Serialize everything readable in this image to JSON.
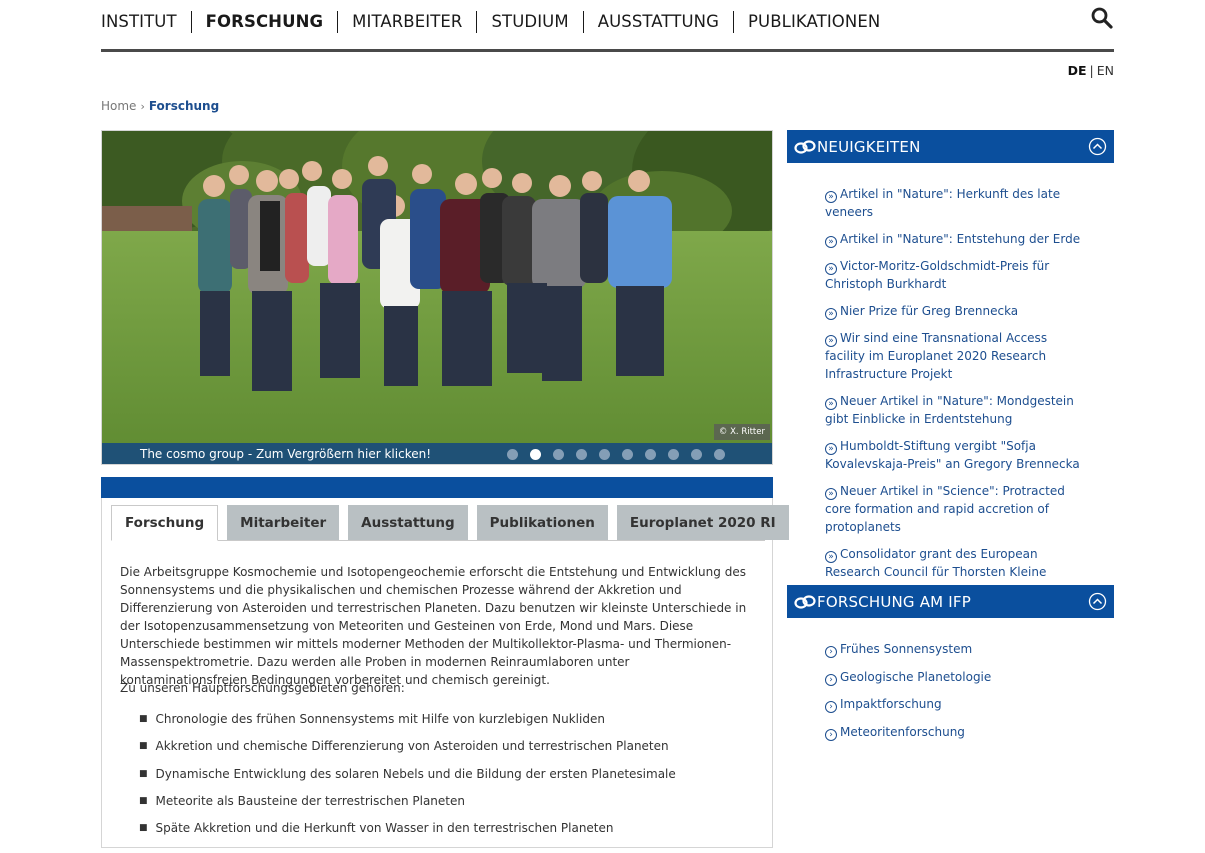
{
  "nav": {
    "items": [
      "INSTITUT",
      "FORSCHUNG",
      "MITARBEITER",
      "STUDIUM",
      "AUSSTATTUNG",
      "PUBLIKATIONEN"
    ],
    "active": "FORSCHUNG",
    "search_icon": "search-icon"
  },
  "lang": {
    "de": "DE",
    "sep": "|",
    "en": "EN"
  },
  "breadcrumb": {
    "home": "Home",
    "separator": "›",
    "current": "Forschung"
  },
  "slider": {
    "copyright": "© X. Ritter",
    "caption": "The cosmo group - Zum Vergrößern hier klicken!",
    "dot_count": 10,
    "active_dot": 2
  },
  "tabs": [
    "Forschung",
    "Mitarbeiter",
    "Ausstattung",
    "Publikationen",
    "Europlanet 2020 RI"
  ],
  "content": {
    "intro": "Die Arbeitsgruppe Kosmochemie und Isotopengeochemie erforscht die Entstehung und Entwicklung des Sonnensystems und die physikalischen und chemischen Prozesse während der Akkretion und Differenzierung von Asteroiden und terrestrischen Planeten. Dazu benutzen wir kleinste Unterschiede in der Isotopenzusammensetzung von Meteoriten und Gesteinen von Erde, Mond und Mars. Diese Unterschiede bestimmen wir mittels moderner Methoden der Multikollektor-Plasma- und Thermionen-Massenspektrometrie. Dazu werden alle Proben in modernen Reinraumlaboren unter kontaminationsfreien Bedingungen vorbereitet und chemisch gereinigt.",
    "subhead": "Zu unseren Hauptforschungsgebieten gehören:",
    "bullets": [
      "Chronologie des frühen Sonnensystems mit Hilfe von kurzlebigen Nukliden",
      "Akkretion und chemische Differenzierung von Asteroiden und terrestrischen Planeten",
      "Dynamische Entwicklung des solaren Nebels und die Bildung der ersten Planetesimale",
      "Meteorite als Bausteine der terrestrischen Planeten",
      "Späte Akkretion und die Herkunft von Wasser in den terrestrischen Planeten"
    ]
  },
  "news": {
    "title": "NEUIGKEITEN",
    "items": [
      "Artikel in \"Nature\": Herkunft des late veneers",
      "Artikel in \"Nature\": Entstehung der Erde",
      "Victor-Moritz-Goldschmidt-Preis für Christoph Burkhardt",
      "Nier Prize für Greg Brennecka",
      "Wir sind eine Transnational Access facility im Europlanet 2020 Research Infrastructure Projekt",
      "Neuer Artikel in \"Nature\": Mondgestein gibt Einblicke in Erdentstehung",
      "Humboldt-Stiftung vergibt \"Sofja Kovalevskaja-Preis\" an Gregory Brennecka",
      "Neuer Artikel in \"Science\": Protracted core formation and rapid accretion of protoplanets",
      "Consolidator grant des European Research Council für Thorsten Kleine"
    ]
  },
  "research": {
    "title": "FORSCHUNG AM IFP",
    "items": [
      "Frühes Sonnensystem",
      "Geologische Planetologie",
      "Impaktforschung",
      "Meteoritenforschung"
    ]
  },
  "colors": {
    "primary_blue": "#0a4f9e",
    "link_blue": "#1d4e8f",
    "tab_grey": "#b9c0c3",
    "grass": "#6f9a3e"
  }
}
